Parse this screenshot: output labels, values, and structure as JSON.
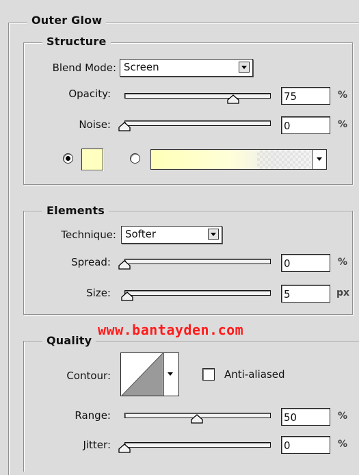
{
  "panel": {
    "title": "Outer Glow",
    "structure": {
      "title": "Structure",
      "blend_mode_label": "Blend Mode:",
      "blend_mode_value": "Screen",
      "opacity_label": "Opacity:",
      "opacity_value": "75",
      "opacity_unit": "%",
      "opacity_level": 0.75,
      "noise_label": "Noise:",
      "noise_value": "0",
      "noise_unit": "%",
      "noise_level": 0,
      "glow_color": "#ffffc0",
      "color_option_selected": "solid"
    },
    "elements": {
      "title": "Elements",
      "technique_label": "Technique:",
      "technique_value": "Softer",
      "spread_label": "Spread:",
      "spread_value": "0",
      "spread_unit": "%",
      "spread_level": 0,
      "size_label": "Size:",
      "size_value": "5",
      "size_unit": "px",
      "size_level": 0.02
    },
    "quality": {
      "title": "Quality",
      "contour_label": "Contour:",
      "anti_aliased_label": "Anti-aliased",
      "anti_aliased_checked": false,
      "range_label": "Range:",
      "range_value": "50",
      "range_unit": "%",
      "range_level": 0.5,
      "jitter_label": "Jitter:",
      "jitter_value": "0",
      "jitter_unit": "%",
      "jitter_level": 0
    }
  },
  "watermark": "www.bantayden.com",
  "colors": {
    "background": "#dcdcdc",
    "watermark": "#ff1a1a"
  }
}
